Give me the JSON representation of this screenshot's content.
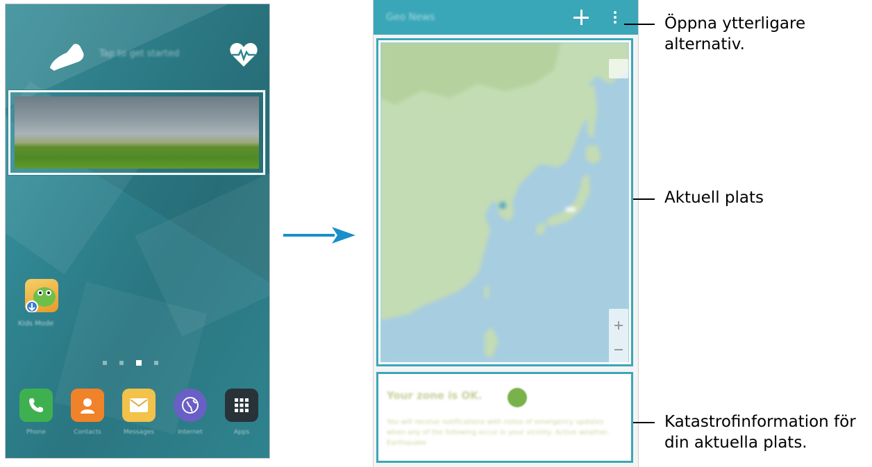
{
  "left_screen": {
    "pager": {
      "pages": 4,
      "active_index": 2
    },
    "dock_apps": [
      {
        "icon": "phone-icon",
        "color": "#3fb04f"
      },
      {
        "icon": "contacts-icon",
        "color": "#f0832a"
      },
      {
        "icon": "messages-icon",
        "color": "#f2c24a"
      },
      {
        "icon": "internet-icon",
        "color": "#6a5fc4"
      },
      {
        "icon": "apps-icon",
        "color": "#283238"
      }
    ]
  },
  "right_screen": {
    "appbar_color": "#3aa7b8",
    "zone_status_color": "#79b24b"
  },
  "callouts": {
    "more_options": "Öppna ytterligare alternativ.",
    "current_location": "Aktuell plats",
    "disaster_info": "Katastrofinformation för din aktuella plats."
  }
}
